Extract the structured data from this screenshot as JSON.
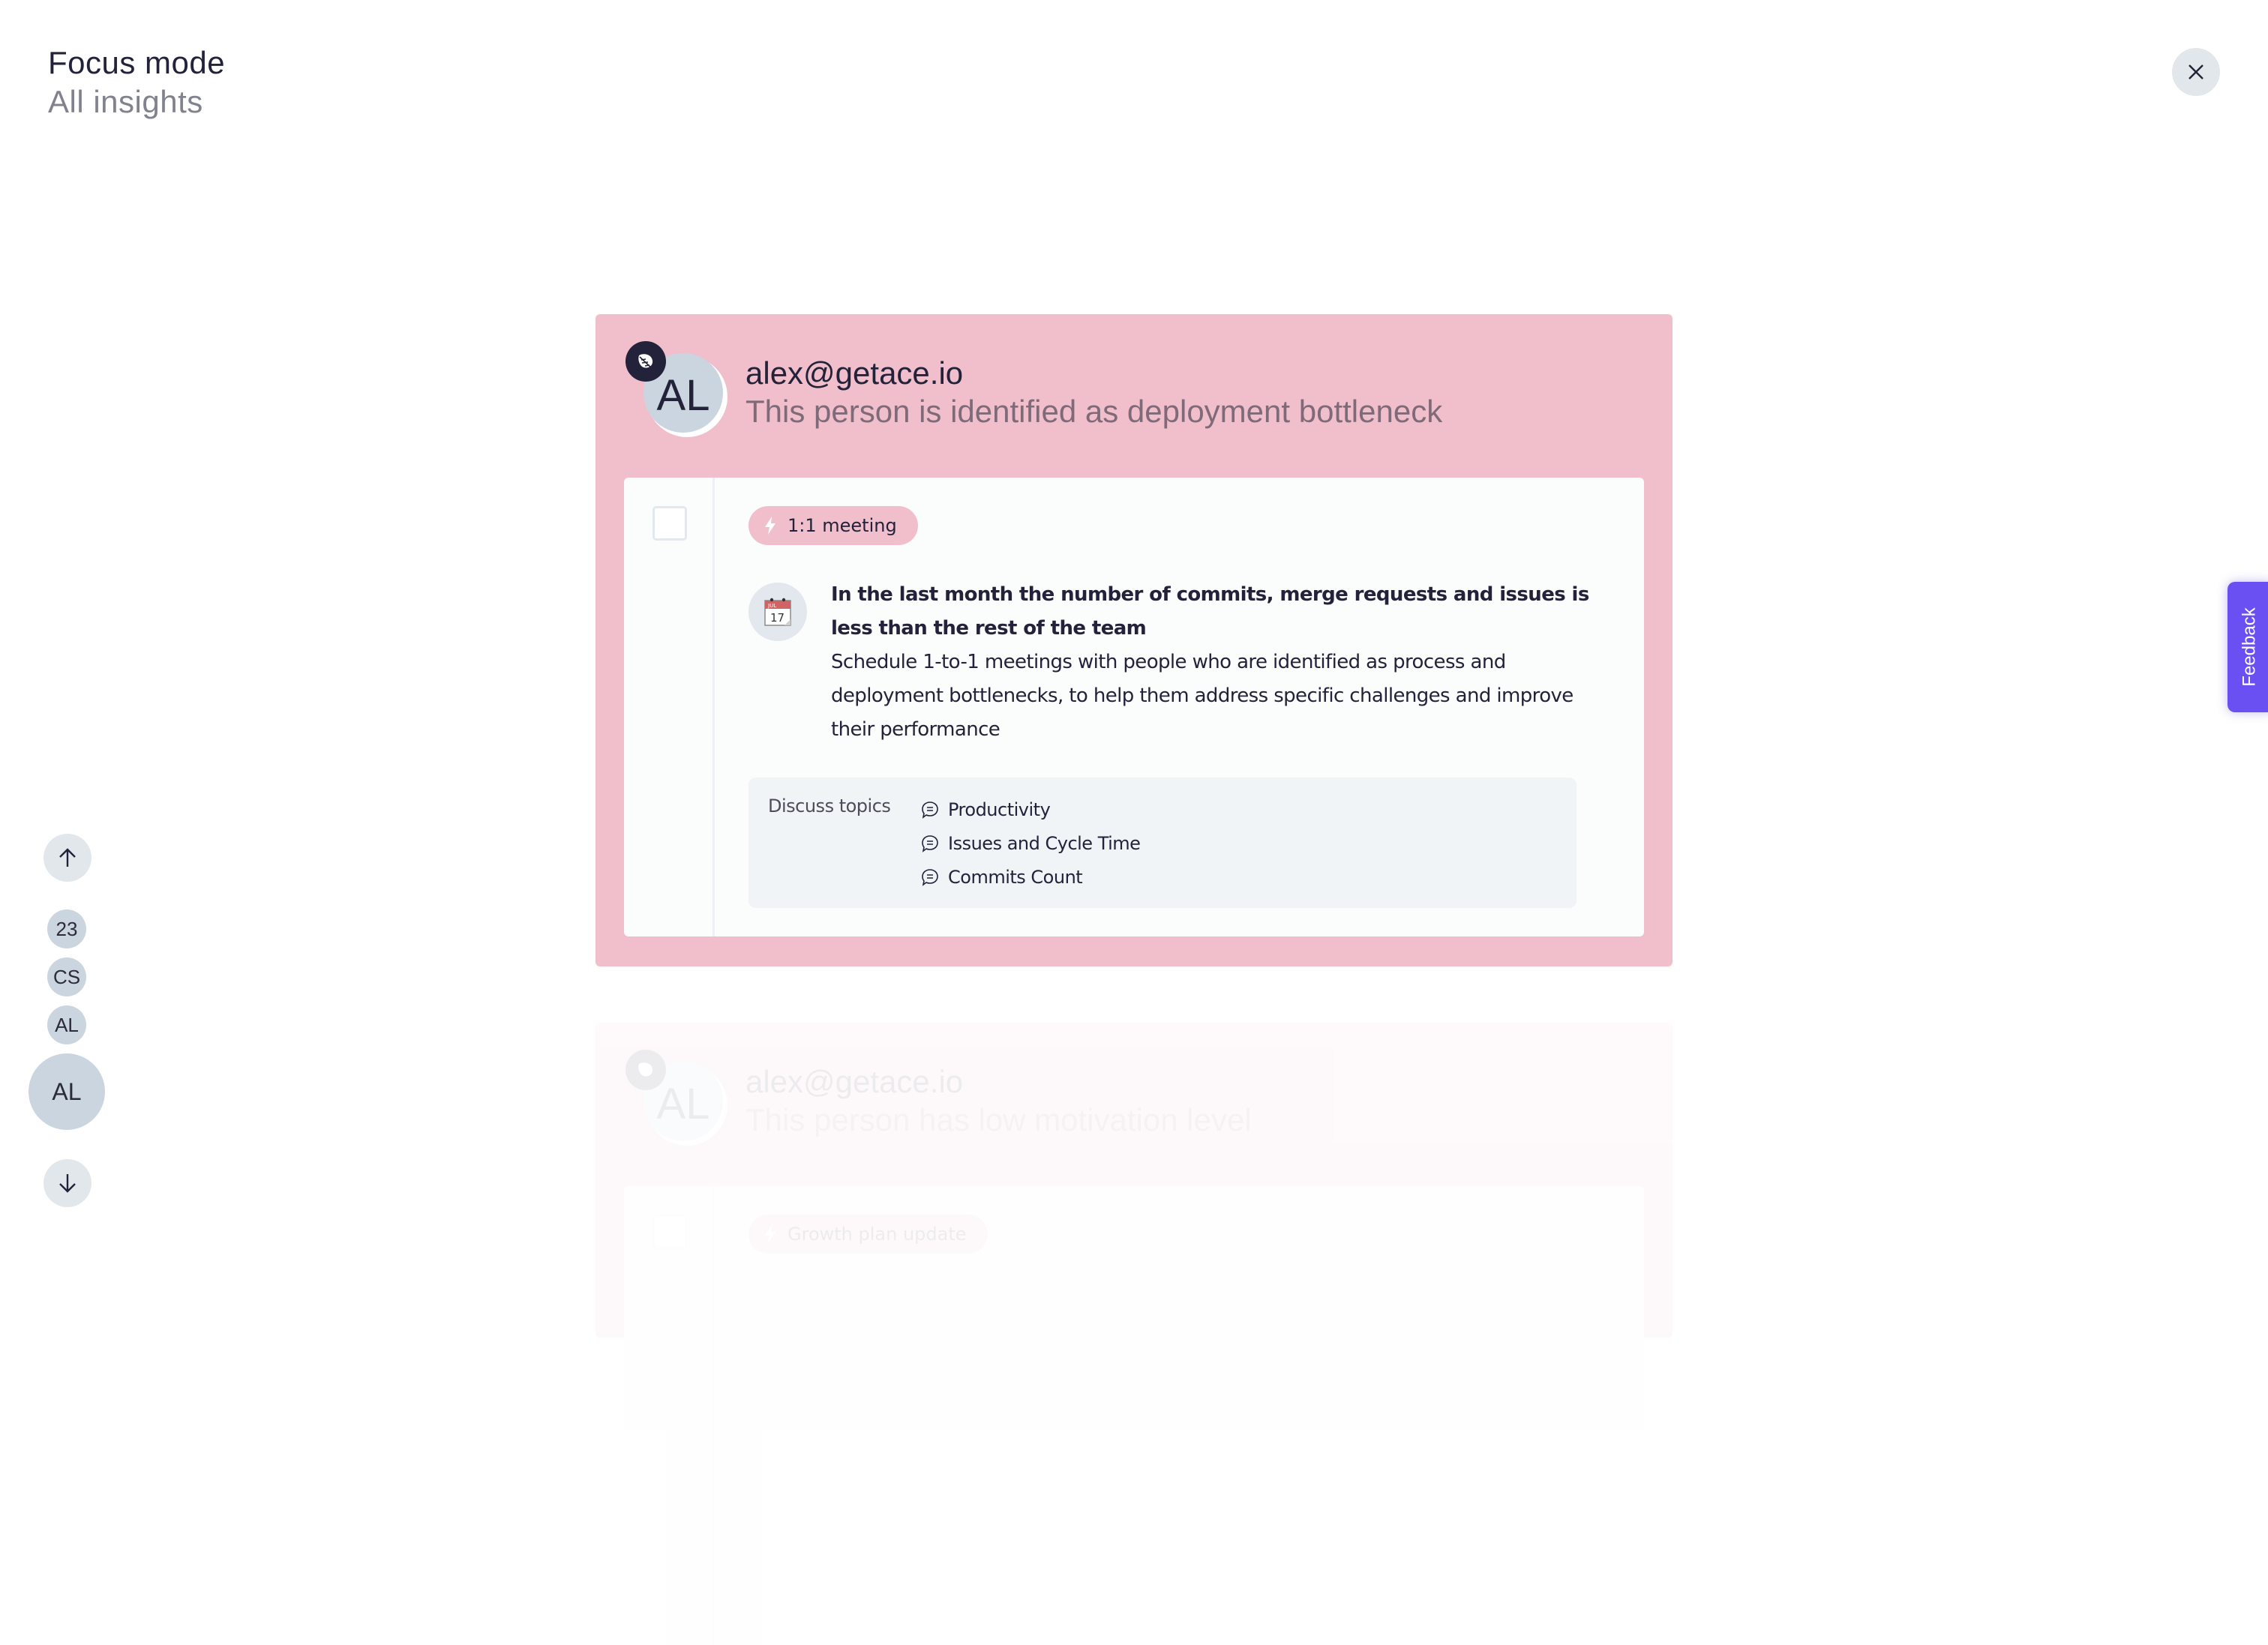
{
  "header": {
    "title": "Focus mode",
    "subtitle": "All insights"
  },
  "feedback": {
    "label": "Feedback",
    "color": "#6a4ff3"
  },
  "nav": {
    "items": [
      {
        "label": "23",
        "size": "small"
      },
      {
        "label": "CS",
        "size": "small"
      },
      {
        "label": "AL",
        "size": "small"
      },
      {
        "label": "AL",
        "size": "large",
        "active": true
      }
    ]
  },
  "insights": [
    {
      "email": "alex@getace.io",
      "description": "This person is identified as deployment bottleneck",
      "avatar_initials": "AL",
      "accent_color": "#f1bfcc",
      "action_tag": "1:1 meeting",
      "finding": "In the last month the number of commits, merge requests and issues is less than the rest of the team",
      "recommendation": "Schedule 1-to-1 meetings with people who are identified as process and deployment bottlenecks, to help them address specific challenges and improve their performance",
      "topics_label": "Discuss topics",
      "topics": [
        "Productivity",
        "Issues and Cycle Time",
        "Commits Count"
      ]
    },
    {
      "email": "alex@getace.io",
      "description": "This person has low motivation level",
      "avatar_initials": "AL",
      "action_tag": "Growth plan update"
    }
  ]
}
